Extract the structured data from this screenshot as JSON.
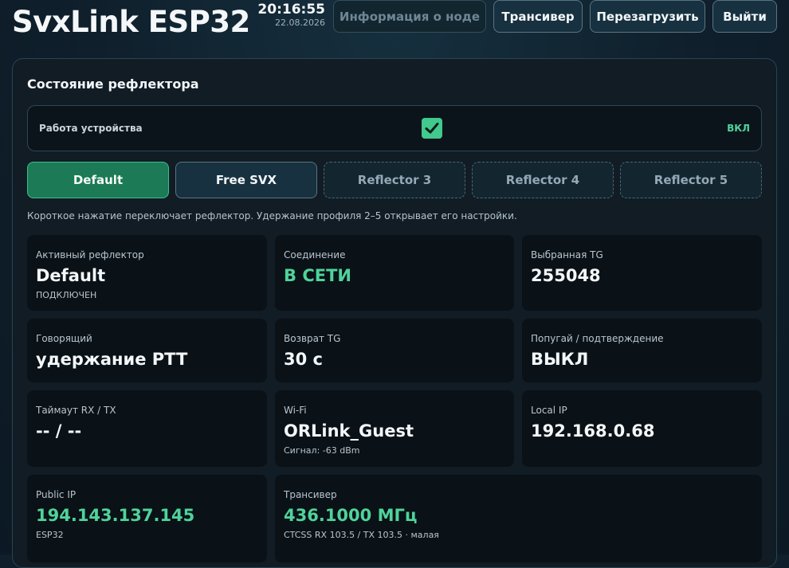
{
  "header": {
    "title": "SvxLink ESP32",
    "time": "20:16:55",
    "date": "22.08.2026",
    "buttons": {
      "node_info": "Информация о ноде",
      "transceiver": "Трансивер",
      "reboot": "Перезагрузить",
      "logout": "Выйти"
    }
  },
  "panel": {
    "title": "Состояние рефлектора",
    "device": {
      "label": "Работа устройства",
      "checked": true,
      "state": "ВКЛ"
    },
    "reflectors": [
      {
        "label": "Default",
        "state": "active"
      },
      {
        "label": "Free SVX",
        "state": "normal"
      },
      {
        "label": "Reflector 3",
        "state": "empty"
      },
      {
        "label": "Reflector 4",
        "state": "empty"
      },
      {
        "label": "Reflector 5",
        "state": "empty"
      }
    ],
    "hint": "Короткое нажатие переключает рефлектор. Удержание профиля 2–5 открывает его настройки.",
    "cards": {
      "active_reflector": {
        "label": "Активный рефлектор",
        "value": "Default",
        "sub": "ПОДКЛЮЧЕН"
      },
      "connection": {
        "label": "Соединение",
        "value": "В СЕТИ"
      },
      "selected_tg": {
        "label": "Выбранная TG",
        "value": "255048"
      },
      "talker": {
        "label": "Говорящий",
        "value": "удержание PTT"
      },
      "tg_return": {
        "label": "Возврат TG",
        "value": "30 с"
      },
      "parrot": {
        "label": "Попугай / подтверждение",
        "value": "ВЫКЛ"
      },
      "timeout": {
        "label": "Таймаут RX / TX",
        "value": "-- / --"
      },
      "wifi": {
        "label": "Wi-Fi",
        "value": "ORLink_Guest",
        "sub": "Сигнал: -63 dBm"
      },
      "local_ip": {
        "label": "Local IP",
        "value": "192.168.0.68"
      },
      "public_ip": {
        "label": "Public IP",
        "value": "194.143.137.145",
        "sub": "ESP32"
      },
      "transceiver": {
        "label": "Трансивер",
        "value": "436.1000 МГц",
        "sub": "CTCSS RX 103.5 / TX 103.5 · малая"
      }
    }
  },
  "colors": {
    "accent_green": "#4fd39a",
    "active_button": "#1c7a57",
    "background": "#0f1f2b"
  }
}
